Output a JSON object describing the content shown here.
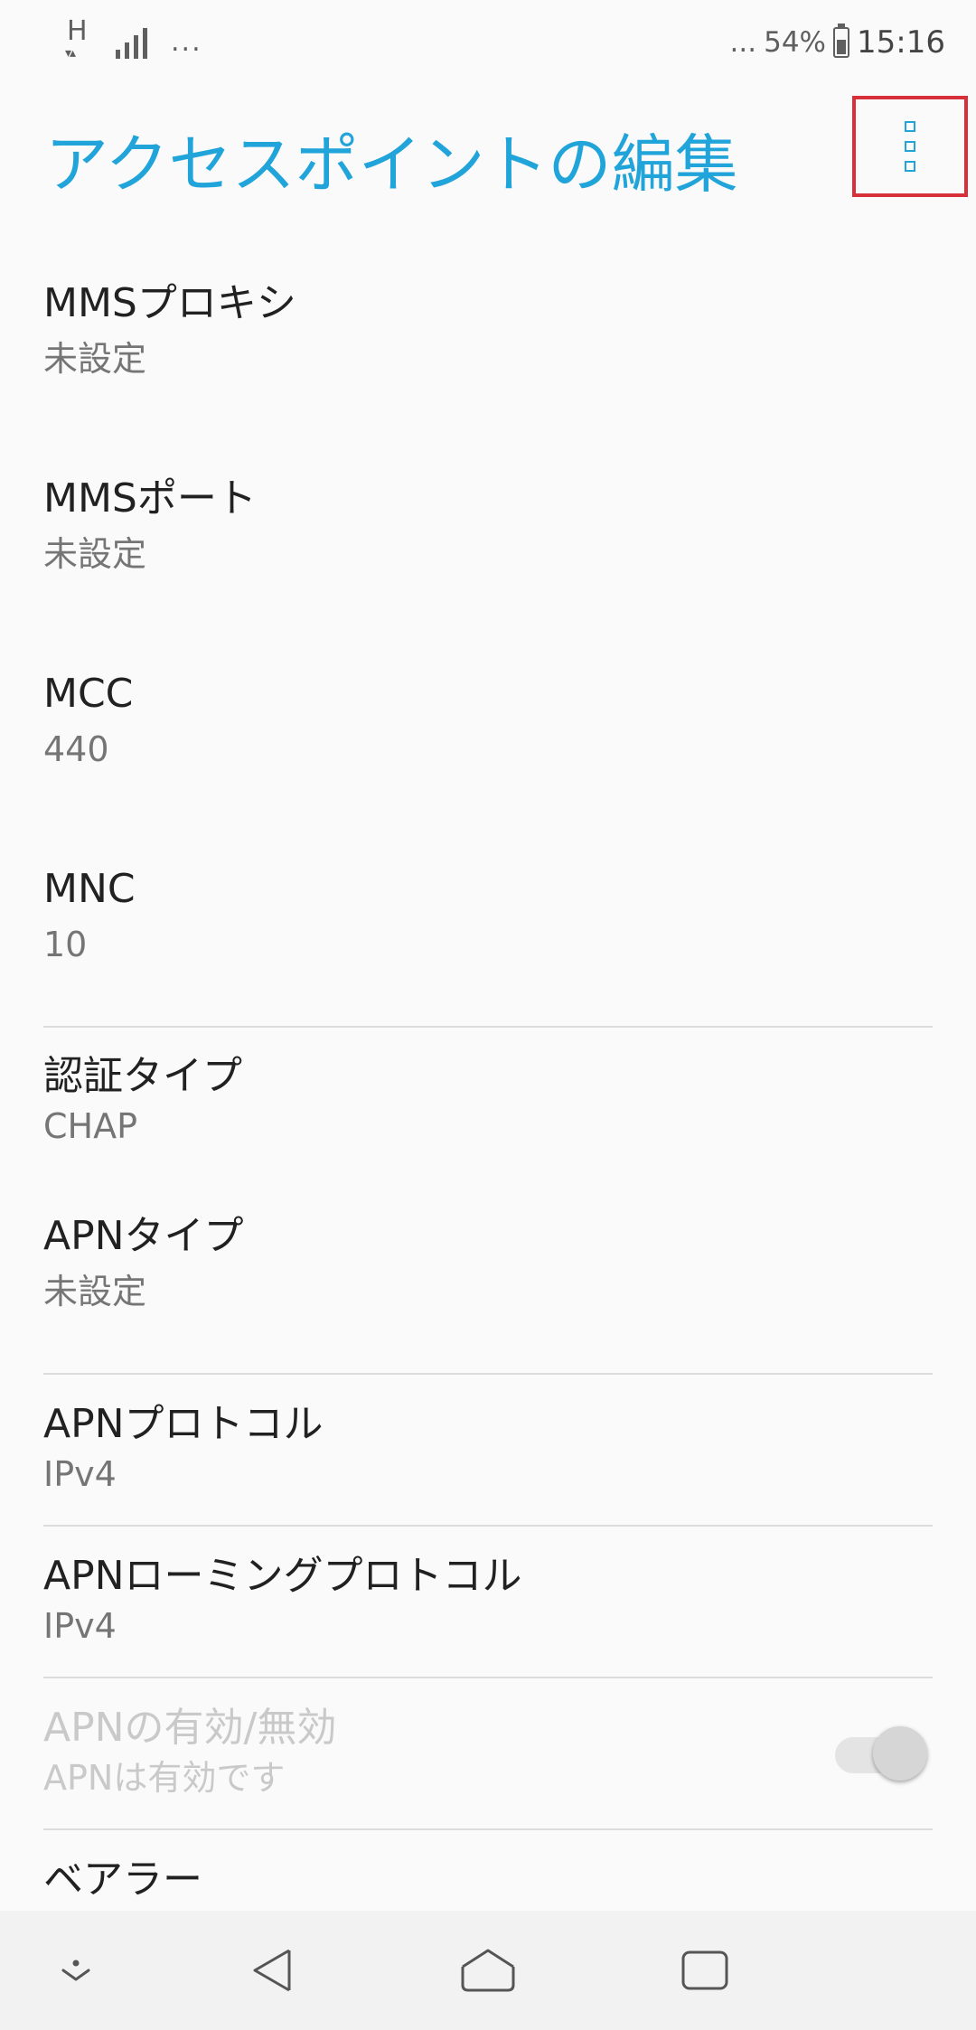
{
  "status_bar": {
    "network_type": "H",
    "network_arrows": "▾▴",
    "overflow_dots": "...",
    "right_dots": "...",
    "battery_percent": "54%",
    "battery_level": 0.54,
    "time": "15:16"
  },
  "header": {
    "title": "アクセスポイントの編集",
    "menu_icon": "more-vert-icon",
    "accent_color": "#20a4d9",
    "highlight_color": "#d8303a"
  },
  "settings": {
    "mms_proxy": {
      "label": "MMSプロキシ",
      "value": "未設定"
    },
    "mms_port": {
      "label": "MMSポート",
      "value": "未設定"
    },
    "mcc": {
      "label": "MCC",
      "value": "440"
    },
    "mnc": {
      "label": "MNC",
      "value": "10"
    },
    "auth_type": {
      "label": "認証タイプ",
      "value": "CHAP"
    },
    "apn_type": {
      "label": "APNタイプ",
      "value": "未設定"
    },
    "apn_protocol": {
      "label": "APNプロトコル",
      "value": "IPv4"
    },
    "apn_roaming_protocol": {
      "label": "APNローミングプロトコル",
      "value": "IPv4"
    },
    "apn_enable": {
      "label": "APNの有効/無効",
      "value": "APNは有効です",
      "enabled": true,
      "disabled_state": true
    },
    "bearer": {
      "label": "ベアラー"
    }
  },
  "navigation": {
    "items": [
      "notification-pull-icon",
      "back-icon",
      "home-icon",
      "recents-icon"
    ]
  }
}
